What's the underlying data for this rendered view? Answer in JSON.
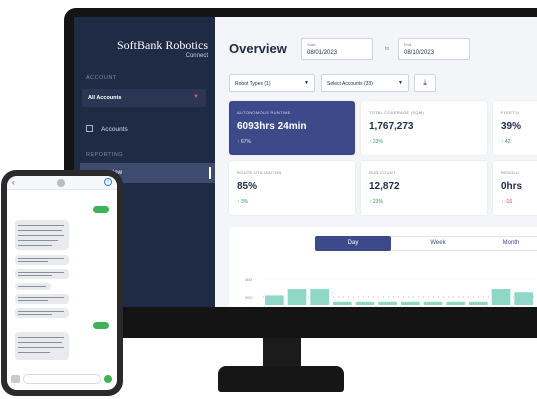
{
  "sidebar": {
    "brand": "SoftBank Robotics",
    "brand_sub": "Connect",
    "account_label": "ACCOUNT",
    "account_select": "All Accounts",
    "accounts_item": "Accounts",
    "reporting_label": "REPORTING",
    "overview_item": "view"
  },
  "header": {
    "title": "Overview",
    "start_caption": "Start",
    "start_date": "08/01/2023",
    "to": "to",
    "end_caption": "End",
    "end_date": "08/10/2023"
  },
  "filters": {
    "robot_types": "Robot Types (1)",
    "accounts": "Select Accounts (33)"
  },
  "cards": [
    {
      "caption": "AUTONOMOUS RUNTIME",
      "value": "6093hrs 24min",
      "delta": "↑ 67%",
      "trend": "up"
    },
    {
      "caption": "TOTAL COVERAGE (SQM)",
      "value": "1,767,273",
      "delta": "↑ 23%",
      "trend": "up"
    },
    {
      "caption": "FLEET U",
      "value": "39%",
      "delta": "↑ 42",
      "trend": "up"
    },
    {
      "caption": "ROUTE UTILIZATION",
      "value": "85%",
      "delta": "↑ 3%",
      "trend": "up"
    },
    {
      "caption": "RUN COUNT",
      "value": "12,872",
      "delta": "↑ 23%",
      "trend": "up"
    },
    {
      "caption": "RESOLU",
      "value": "0hrs",
      "delta": "↓ -16",
      "trend": "down"
    }
  ],
  "tabs": [
    "Day",
    "Week",
    "Month"
  ],
  "chart_data": {
    "type": "bar",
    "y_ticks": [
      "300",
      "200"
    ],
    "values": [
      0.6,
      1,
      1,
      0.2,
      0.2,
      0.2,
      0.2,
      0.2,
      0.2,
      0.2,
      1,
      0.8
    ],
    "ylim": [
      0,
      1
    ]
  },
  "colors": {
    "sidebar": "#1f2a44",
    "accent": "#3c4a8a",
    "positive": "#2f9b5a",
    "negative": "#d64545",
    "chart_bar": "#8fd8c7"
  }
}
